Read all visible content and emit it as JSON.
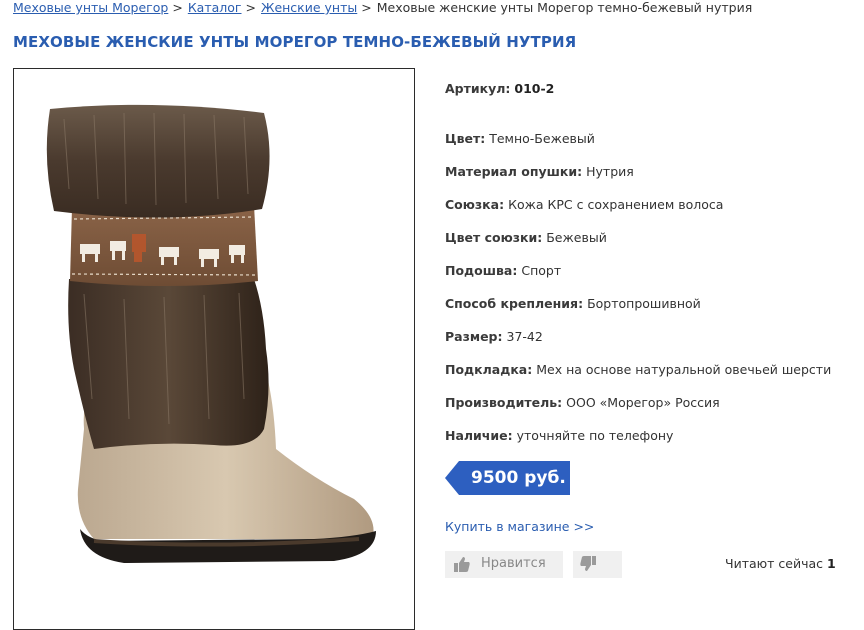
{
  "breadcrumb": {
    "items": [
      {
        "label": "Меховые унты Морегор",
        "link": true
      },
      {
        "label": "Каталог",
        "link": true
      },
      {
        "label": "Женские унты",
        "link": true
      },
      {
        "label": "Меховые женские унты Морегор темно-бежевый нутрия",
        "link": false
      }
    ],
    "separator": ">"
  },
  "page_title": "МЕХОВЫЕ ЖЕНСКИЕ УНТЫ МОРЕГОР ТЕМНО-БЕЖЕВЫЙ НУТРИЯ",
  "product_image_alt": "boot",
  "specs": [
    {
      "key": "Артикул:",
      "value": "010-2",
      "bold_value": true
    },
    {
      "key": "Цвет:",
      "value": "Темно-Бежевый"
    },
    {
      "key": "Материал опушки:",
      "value": "Нутрия"
    },
    {
      "key": "Союзка:",
      "value": "Кожа КРС с сохранением волоса"
    },
    {
      "key": "Цвет союзки:",
      "value": "Бежевый"
    },
    {
      "key": "Подошва:",
      "value": "Спорт"
    },
    {
      "key": "Способ крепления:",
      "value": "Бортопрошивной"
    },
    {
      "key": "Размер:",
      "value": "37-42"
    },
    {
      "key": "Подкладка:",
      "value": "Мех на основе натуральной овечьей шерсти"
    },
    {
      "key": "Производитель:",
      "value": "ООО «Морегор» Россия"
    },
    {
      "key": "Наличие:",
      "value": "уточняйте по телефону"
    }
  ],
  "price": "9500 руб.",
  "buy_link": "Купить в магазине >>",
  "like": {
    "label": "Нравится",
    "icon": "thumbs-up-icon"
  },
  "dislike": {
    "icon": "thumbs-down-icon"
  },
  "reading_now": {
    "label": "Читают сейчас",
    "count": "1"
  },
  "colors": {
    "link": "#2a5db0",
    "price_tag": "#2d5fc0",
    "button_bg": "#f0f0f0"
  }
}
